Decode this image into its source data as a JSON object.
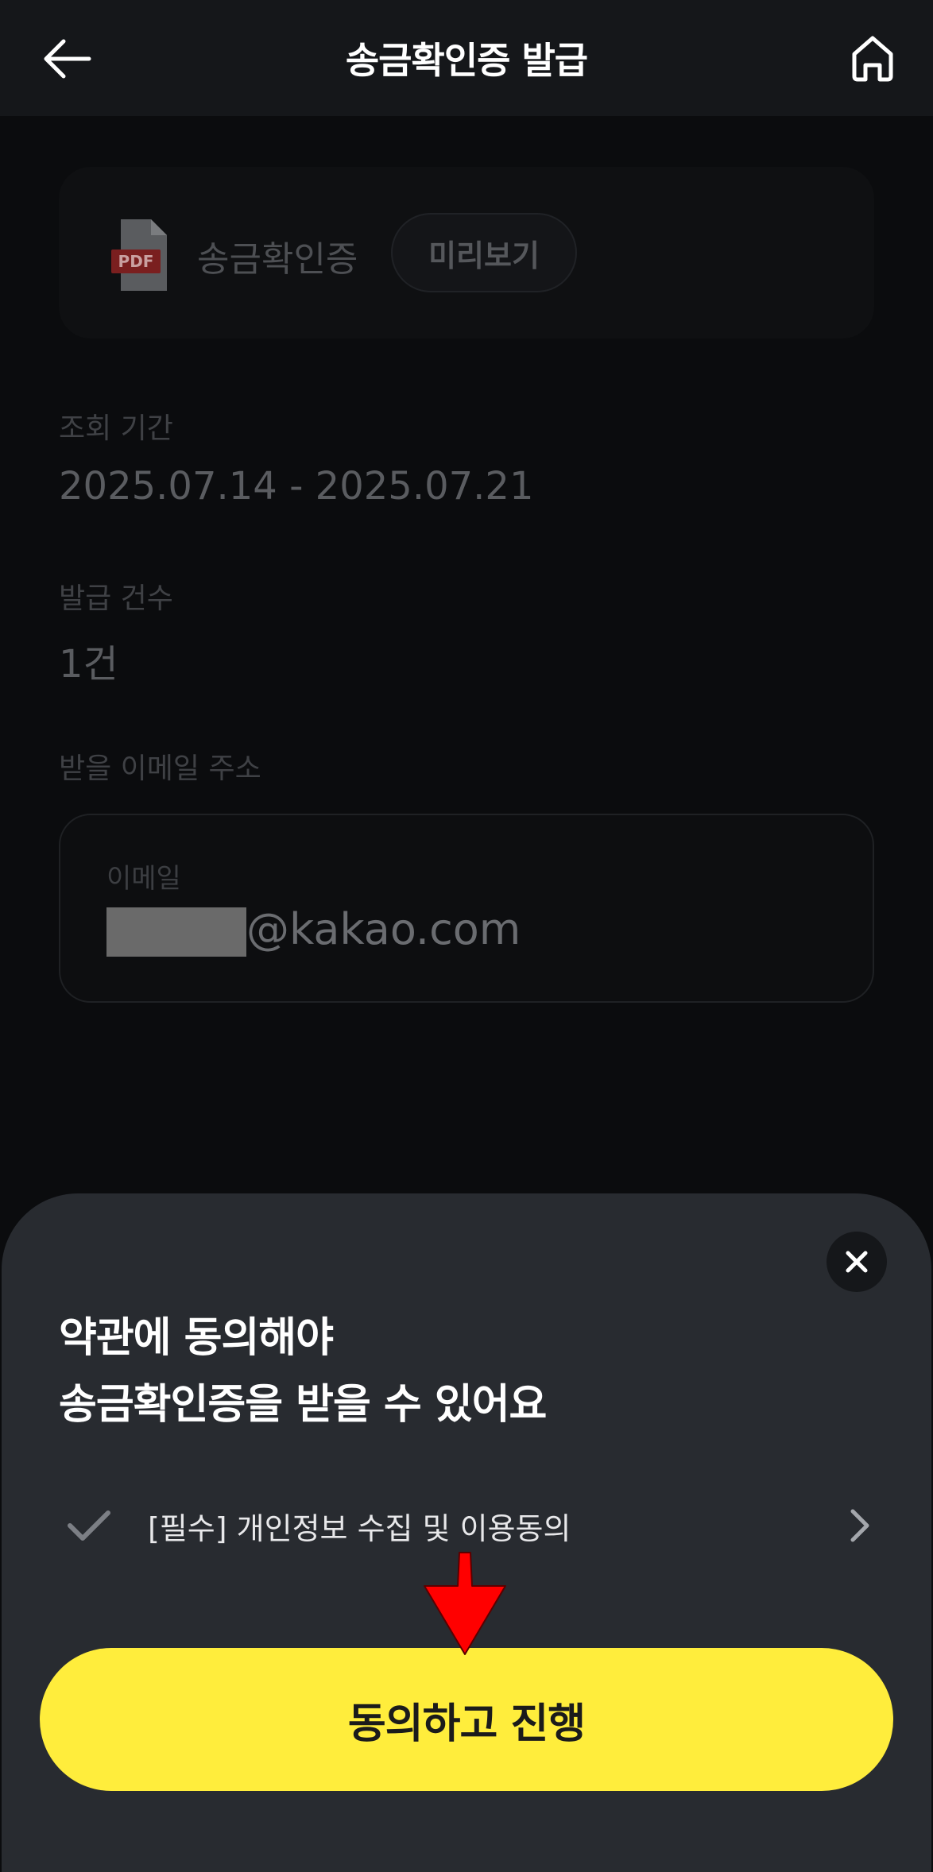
{
  "header": {
    "title": "송금확인증 발급",
    "back_icon": "arrow-left-icon",
    "home_icon": "home-icon"
  },
  "document": {
    "file_badge": "PDF",
    "name": "송금확인증",
    "preview_label": "미리보기"
  },
  "period": {
    "label": "조회 기간",
    "value": "2025.07.14 - 2025.07.21"
  },
  "count": {
    "label": "발급 건수",
    "value": "1건"
  },
  "email": {
    "section_label": "받을 이메일 주소",
    "field_label": "이메일",
    "domain": "@kakao.com"
  },
  "sheet": {
    "title_line1": "약관에 동의해야",
    "title_line2": "송금확인증을 받을 수 있어요",
    "agreement_text": "[필수] 개인정보 수집 및 이용동의",
    "confirm_label": "동의하고 진행"
  },
  "colors": {
    "accent": "#ffed3c",
    "sheet_bg": "#282b30",
    "annotation": "#ff0000"
  }
}
